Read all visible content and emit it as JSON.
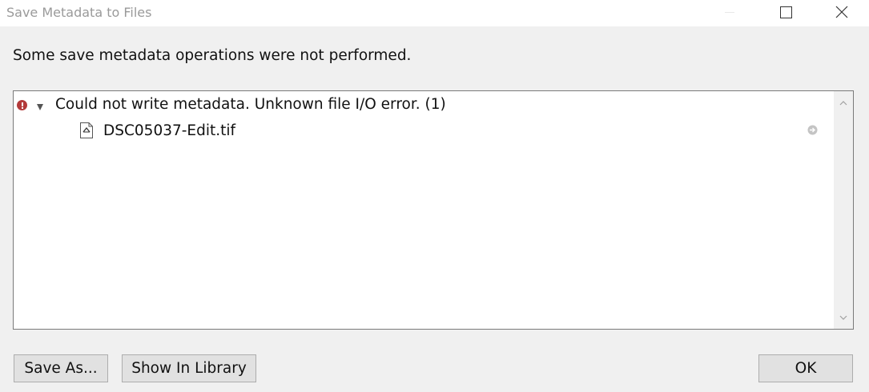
{
  "window": {
    "title": "Save Metadata to Files"
  },
  "message": "Some save metadata operations were not performed.",
  "results": {
    "error": {
      "text": "Could not write metadata. Unknown file I/O error. (1)",
      "icon": "error-icon",
      "color": "#b33a3a",
      "expanded": true
    },
    "files": [
      {
        "name": "DSC05037-Edit.tif",
        "icon": "tif-file-icon"
      }
    ]
  },
  "buttons": {
    "save_as": "Save As...",
    "show_in_library": "Show In Library",
    "ok": "OK"
  }
}
